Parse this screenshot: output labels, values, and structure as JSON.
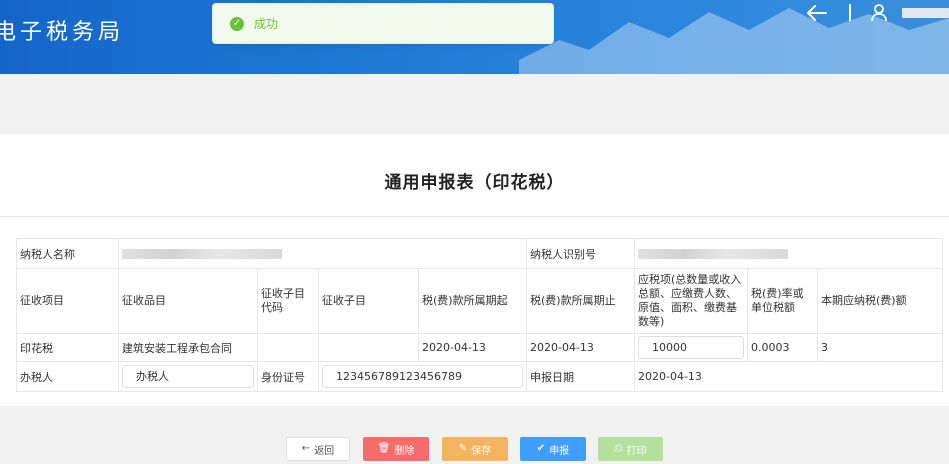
{
  "header": {
    "brand": "电子税务局",
    "back_icon": "arrow-left-icon",
    "user_icon": "user-icon",
    "colors": {
      "primary": "#1f7ad6"
    }
  },
  "toast": {
    "icon": "check-circle-icon",
    "message": "成功",
    "color": "#67c23a"
  },
  "form": {
    "title": "通用申报表（印花税）",
    "taxpayer_name_label": "纳税人名称",
    "taxpayer_id_label": "纳税人识别号",
    "columns": [
      "征收项目",
      "征收品目",
      "征收子目代码",
      "征收子目",
      "税(费)款所属期起",
      "税(费)款所属期止",
      "应税项(总数量或收入总额、应缴费人数、原值、面积、缴费基数等)",
      "税(费)率或单位税额",
      "本期应纳税(费)额"
    ],
    "row": {
      "item": "印花税",
      "category": "建筑安装工程承包合同",
      "sub_code": "",
      "sub_item": "",
      "period_start": "2020-04-13",
      "period_end": "2020-04-13",
      "taxable_amount": "10000",
      "rate": "0.0003",
      "tax_due": "3"
    },
    "handler_label": "办税人",
    "handler_value": "办税人",
    "id_label": "身份证号",
    "id_value": "123456789123456789",
    "date_label": "申报日期",
    "date_value": "2020-04-13"
  },
  "buttons": {
    "back": "返回",
    "delete": "删除",
    "save": "保存",
    "submit": "申报",
    "print": "打印"
  }
}
